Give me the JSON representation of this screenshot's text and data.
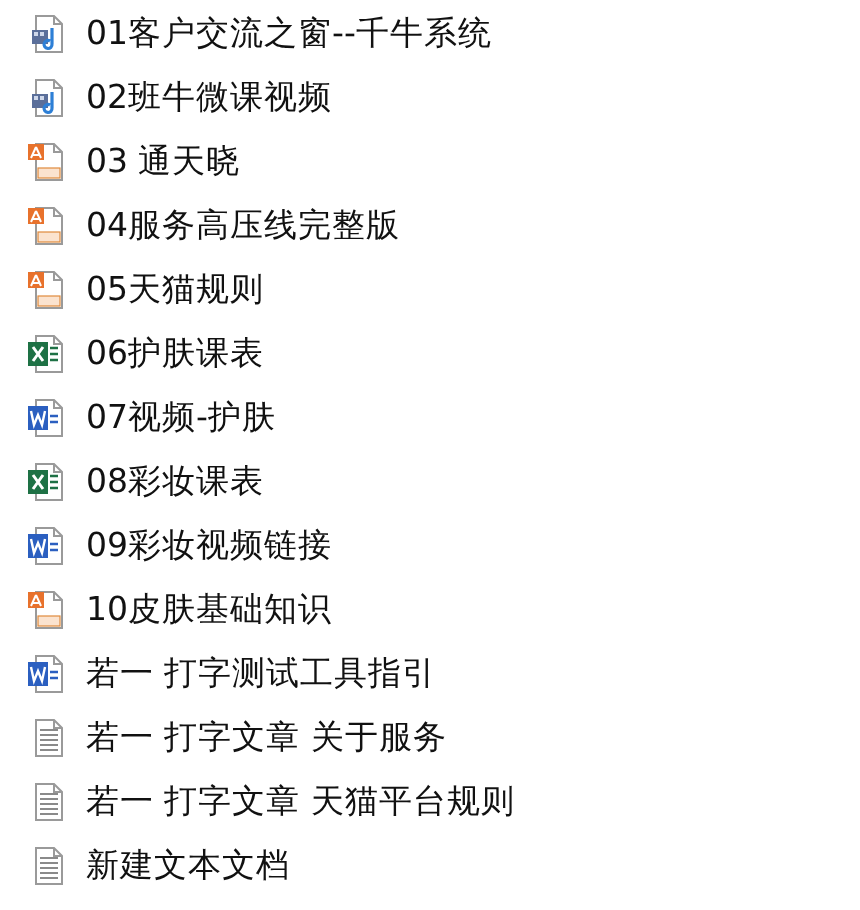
{
  "files": [
    {
      "name": "01客户交流之窗--千牛系统",
      "kind": "video"
    },
    {
      "name": "02班牛微课视频",
      "kind": "video"
    },
    {
      "name": "03 通天晓",
      "kind": "pdf"
    },
    {
      "name": "04服务高压线完整版",
      "kind": "pdf"
    },
    {
      "name": "05天猫规则",
      "kind": "pdf"
    },
    {
      "name": "06护肤课表",
      "kind": "excel"
    },
    {
      "name": "07视频-护肤",
      "kind": "word"
    },
    {
      "name": "08彩妆课表",
      "kind": "excel"
    },
    {
      "name": "09彩妆视频链接",
      "kind": "word"
    },
    {
      "name": "10皮肤基础知识",
      "kind": "pdf"
    },
    {
      "name": "若一 打字测试工具指引",
      "kind": "word"
    },
    {
      "name": "若一 打字文章 关于服务",
      "kind": "text"
    },
    {
      "name": "若一 打字文章 天猫平台规则",
      "kind": "text"
    },
    {
      "name": "新建文本文档",
      "kind": "text"
    }
  ]
}
